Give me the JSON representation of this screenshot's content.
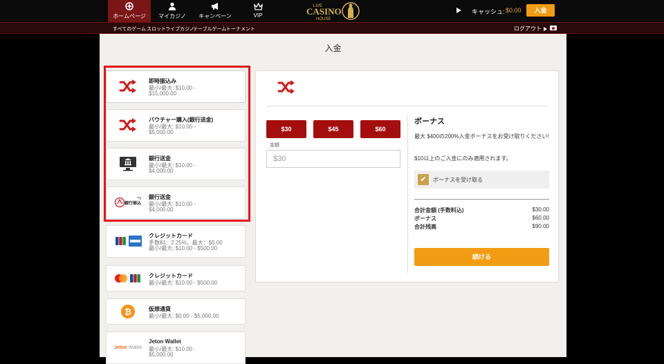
{
  "nav": {
    "home": "ホームページ",
    "my_casino": "マイカジノ",
    "campaign": "キャンペーン",
    "vip": "VIP"
  },
  "logo": {
    "line1": "LIVE",
    "line2": "CASINO",
    "line3": "HOUSE"
  },
  "header": {
    "cash_label": "キャッシュ:",
    "cash_value": "$0.00",
    "deposit_button": "入金"
  },
  "subnav": {
    "items": [
      "すべてのゲーム",
      "スロット",
      "ライブカジノ",
      "テーブルゲーム",
      "トーナメント"
    ],
    "logout": "ログアウト"
  },
  "page": {
    "title": "入金"
  },
  "methods": [
    {
      "name": "即時振込み",
      "lines": [
        "最小/最大: $10.00 -",
        "$15,000.00"
      ],
      "icon": "shuffle-icon"
    },
    {
      "name": "バウチャー購入(銀行送金)",
      "lines": [
        "最小/最大: $10.00 -",
        "$5,000.00"
      ],
      "icon": "shuffle-icon"
    },
    {
      "name": "銀行送金",
      "lines": [
        "最小/最大: $10.00 -",
        "$4,000.00"
      ],
      "icon": "bank-monitor-icon"
    },
    {
      "name": "銀行送金",
      "lines": [
        "最小/最大: $10.00 -",
        "$4,000.00"
      ],
      "icon": "bank-logo-icon",
      "logo_text": "銀行振込"
    },
    {
      "name": "クレジットカード",
      "lines": [
        "手数料：2.25%，最大：$5.00",
        "最小/最大: $10.00 - $500.00"
      ],
      "icon": "jcb-amex-icon"
    },
    {
      "name": "クレジットカード",
      "lines": [
        "最小/最大: $10.00 - $500.00"
      ],
      "icon": "mastercard-jcb-icon"
    },
    {
      "name": "仮想通貨",
      "lines": [
        "最小/最大: $0.00 - $5,000.00"
      ],
      "icon": "bitcoin-icon"
    },
    {
      "name": "Jeton Wallet",
      "lines": [
        "最小/最大: $10.00 -",
        "$5,000.00"
      ],
      "icon": "jeton-logo-icon",
      "logo_text": "Jeton",
      "logo_text2": "Wallet"
    }
  ],
  "panel": {
    "amount_buttons": [
      "$30",
      "$45",
      "$60"
    ],
    "amount_label": "金額",
    "amount_value": "$30",
    "bonus": {
      "title": "ボーナス",
      "description": "最大 $400の200%入金ボーナスをお受け取りください!",
      "note": "$10以上のご入金にのみ適用されます。",
      "checkbox_label": "ボーナスを受け取る",
      "checked": true
    },
    "summary": [
      {
        "label": "合計金額 (手数料込)",
        "value": "$30.00"
      },
      {
        "label": "ボーナス",
        "value": "$60.00"
      },
      {
        "label": "合計残高",
        "value": "$90.00"
      }
    ],
    "continue_button": "続ける"
  },
  "colors": {
    "accent_red": "#a40e0e",
    "accent_orange": "#f39b13",
    "gold": "#c9a24a",
    "highlight": "#e5141b"
  }
}
